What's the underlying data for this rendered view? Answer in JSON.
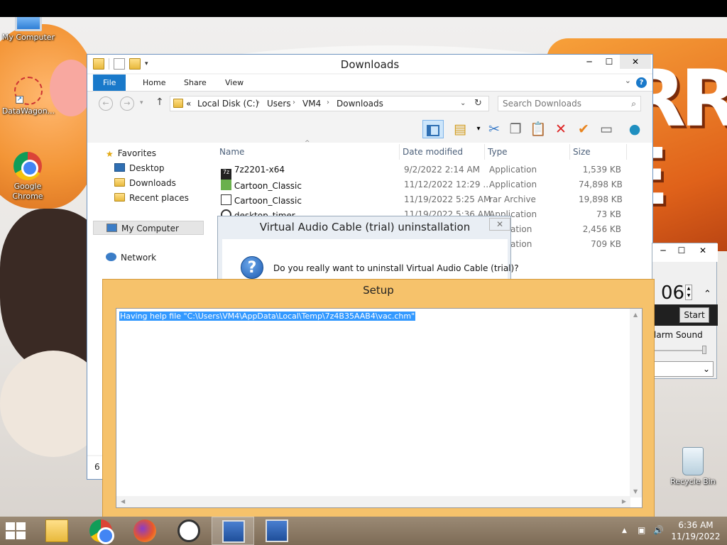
{
  "desktop": {
    "icons": [
      {
        "label": "My Computer"
      },
      {
        "label": "DataWagon..."
      },
      {
        "label": "Google Chrome"
      },
      {
        "label": "Recycle Bin"
      }
    ],
    "wallpaper_text": "URR\nEE"
  },
  "explorer": {
    "title": "Downloads",
    "ribbon_tabs": [
      "File",
      "Home",
      "Share",
      "View"
    ],
    "help_label": "?",
    "breadcrumb": [
      "Local Disk (C:)",
      "Users",
      "VM4",
      "Downloads"
    ],
    "breadcrumb_prefix": "«",
    "search_placeholder": "Search Downloads",
    "nav": {
      "favorites": "Favorites",
      "desktop": "Desktop",
      "downloads": "Downloads",
      "recent": "Recent places",
      "my_computer": "My Computer",
      "network": "Network"
    },
    "columns": {
      "name": "Name",
      "date": "Date modified",
      "type": "Type",
      "size": "Size"
    },
    "files": [
      {
        "name": "7z2201-x64",
        "date": "9/2/2022 2:14 AM",
        "type": "Application",
        "size": "1,539 KB",
        "icon": "7z-icon"
      },
      {
        "name": "Cartoon_Classic",
        "date": "11/12/2022 12:29 ...",
        "type": "Application",
        "size": "74,898 KB",
        "icon": "cube-icon"
      },
      {
        "name": "Cartoon_Classic",
        "date": "11/19/2022 5:25 AM",
        "type": "rar Archive",
        "size": "19,898 KB",
        "icon": "rar-icon"
      },
      {
        "name": "desktop_timer",
        "date": "11/19/2022 5:36 AM",
        "type": "Application",
        "size": "73 KB",
        "icon": "clock-icon"
      },
      {
        "name": "",
        "date": "",
        "type": "ation",
        "size": "2,456 KB",
        "icon": ""
      },
      {
        "name": "",
        "date": "",
        "type": "ation",
        "size": "709 KB",
        "icon": ""
      }
    ],
    "status": "6 i"
  },
  "timer": {
    "value": "06",
    "start_label": "Start",
    "alarm_label": "larm Sound"
  },
  "uninstall_dialog": {
    "title": "Virtual Audio Cable (trial) uninstallation",
    "message": "Do you really want to uninstall Virtual Audio Cable (trial)?",
    "close": "✕"
  },
  "setup": {
    "title": "Setup",
    "log_line": "Having help file \"C:\\Users\\VM4\\AppData\\Local\\Temp\\7z4B35AAB4\\vac.chm\""
  },
  "taskbar": {
    "time": "6:36 AM",
    "date": "11/19/2022",
    "apps": [
      "file-explorer",
      "google-chrome",
      "firefox",
      "desktop-timer",
      "setup-app",
      "setup-app-2"
    ]
  },
  "colors": {
    "accent": "#1979ca",
    "setup_frame": "#f6c26b",
    "selection": "#3399ff",
    "taskbar": "#8e7a62"
  }
}
